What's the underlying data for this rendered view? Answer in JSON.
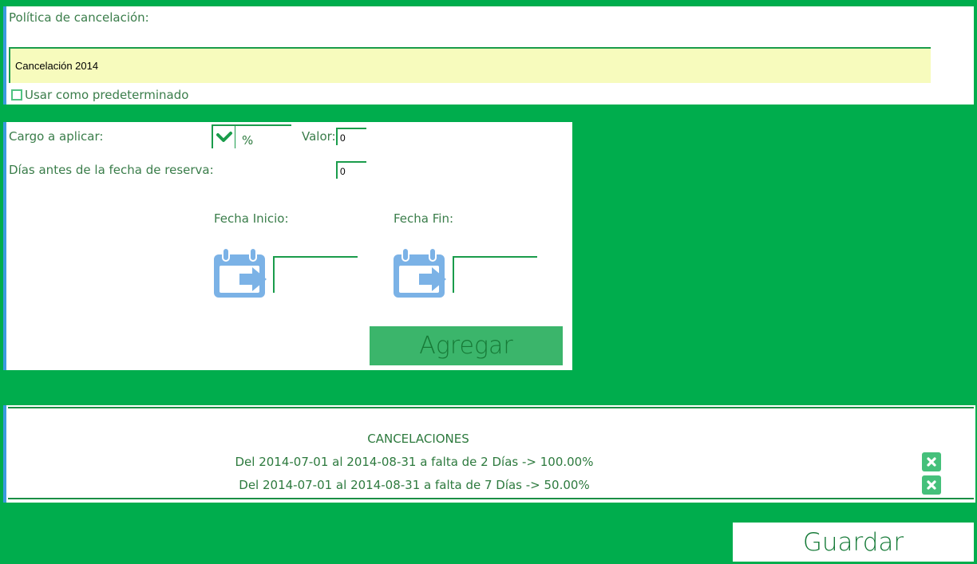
{
  "policy": {
    "label": "Política de cancelación:",
    "name_value": "Cancelación 2014",
    "default_label": "Usar como predeterminado"
  },
  "charge": {
    "label": "Cargo a aplicar:",
    "type_selected": "%",
    "value_label": "Valor:",
    "value": "0",
    "days_label": "Días antes de la fecha de reserva:",
    "days_value": "0"
  },
  "dates": {
    "start_label": "Fecha Inicio:",
    "end_label": "Fecha Fin:",
    "start_value": "",
    "end_value": ""
  },
  "add_label": "Agregar",
  "cancellations": {
    "title": "CANCELACIONES",
    "items": [
      "Del 2014-07-01 al 2014-08-31 a falta de 2 Días -> 100.00%",
      "Del 2014-07-01 al 2014-08-31 a falta de 7 Días -> 50.00%"
    ]
  },
  "save_label": "Guardar",
  "colors": {
    "background": "#00ad4d",
    "accent": "#1a9c4b",
    "input_highlight": "#f7fbbd",
    "calendar_icon": "#7bb2e6",
    "add_button": "#3bb56b"
  },
  "icons": {
    "dropdown": "chevron-down-icon",
    "calendar": "calendar-arrow-icon",
    "delete": "close-icon"
  }
}
